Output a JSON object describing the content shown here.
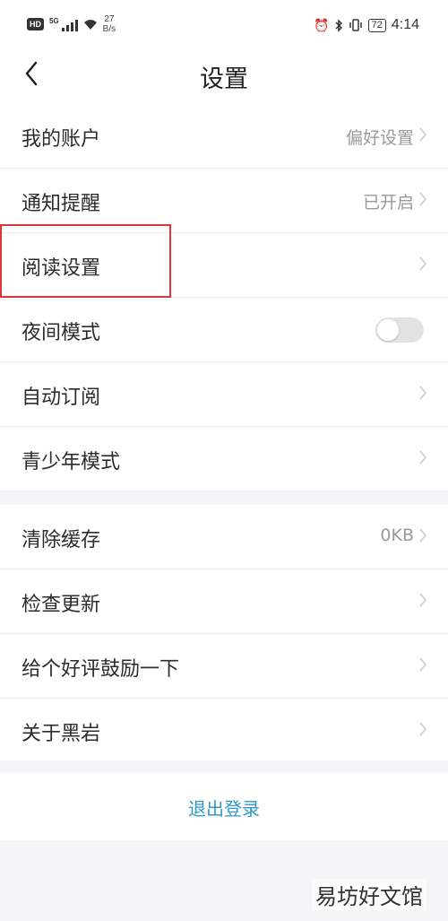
{
  "status_bar": {
    "hd": "HD",
    "network": "5G",
    "speed_value": "27",
    "speed_unit": "B/s",
    "battery": "72",
    "time": "4:14",
    "icons": [
      "alarm-icon",
      "bluetooth-icon",
      "vibrate-icon"
    ]
  },
  "header": {
    "title": "设置",
    "back_icon": "chevron-left-icon"
  },
  "group1": [
    {
      "label": "我的账户",
      "value": "偏好设置"
    },
    {
      "label": "通知提醒",
      "value": "已开启"
    },
    {
      "label": "阅读设置",
      "value": ""
    },
    {
      "label": "夜间模式",
      "toggle": false
    },
    {
      "label": "自动订阅",
      "value": ""
    },
    {
      "label": "青少年模式",
      "value": ""
    }
  ],
  "group2": [
    {
      "label": "清除缓存",
      "value": "0KB"
    },
    {
      "label": "检查更新",
      "value": ""
    },
    {
      "label": "给个好评鼓励一下",
      "value": ""
    },
    {
      "label": "关于黑岩",
      "value": ""
    }
  ],
  "logout": "退出登录",
  "watermark": "易坊好文馆",
  "colors": {
    "accent": "#2e97c4",
    "highlight": "#e0333a",
    "divider": "#ececec"
  }
}
